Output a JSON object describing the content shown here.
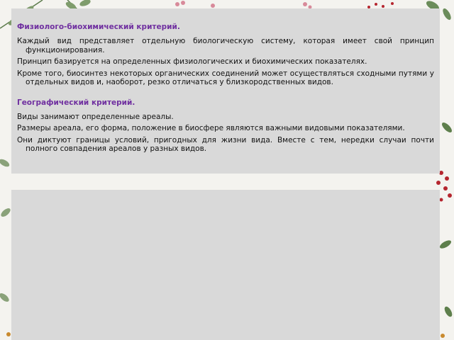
{
  "slide": {
    "sections": [
      {
        "title": "Физиолого-биохимический критерий.",
        "paragraphs": [
          "Каждый вид представляет отдельную биологическую систему, которая имеет свой принцип функционирования.",
          "Принцип базируется на определенных физиологических и биохимических показателях.",
          "Кроме того, биосинтез некоторых органических соединений может осуществляться сходными путями у отдельных видов и, наоборот, резко отличаться у близкородственных видов."
        ]
      },
      {
        "title": "Географический критерий.",
        "paragraphs": [
          "Виды занимают определенные ареалы.",
          "Размеры ареала, его форма, положение в биосфере являются важными видовыми показателями.",
          "Они диктуют границы условий, пригодных для жизни вида. Вместе с тем, нередки случаи почти полного совпадения ареалов у разных видов."
        ]
      }
    ]
  },
  "colors": {
    "heading": "#7030a0",
    "panel": "#d9d9d9",
    "background": "#f4f3ef"
  }
}
